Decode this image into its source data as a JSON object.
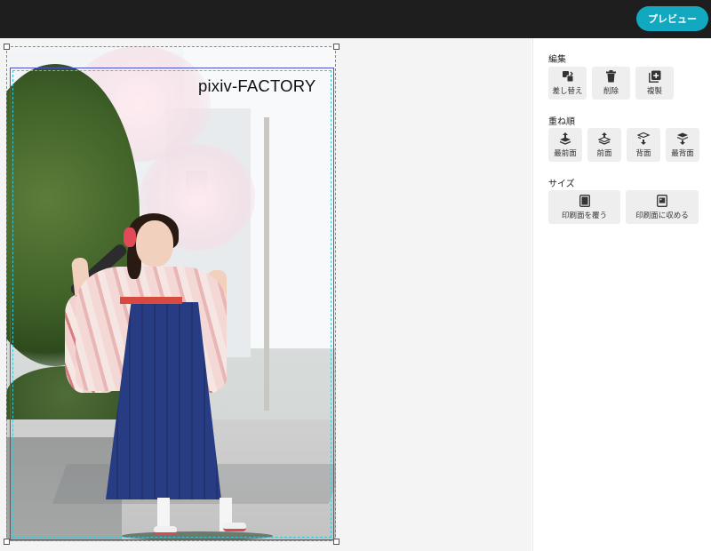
{
  "header": {
    "preview_label": "プレビュー"
  },
  "artwork": {
    "watermark": "pixiv-FACTORY"
  },
  "panel": {
    "edit": {
      "title": "編集",
      "buttons": [
        {
          "label": "差し替え",
          "icon": "swap-image-icon"
        },
        {
          "label": "削除",
          "icon": "trash-icon"
        },
        {
          "label": "複製",
          "icon": "duplicate-icon"
        }
      ]
    },
    "order": {
      "title": "重ね順",
      "buttons": [
        {
          "label": "最前面",
          "icon": "bring-to-front-icon"
        },
        {
          "label": "前面",
          "icon": "bring-forward-icon"
        },
        {
          "label": "背面",
          "icon": "send-backward-icon"
        },
        {
          "label": "最背面",
          "icon": "send-to-back-icon"
        }
      ]
    },
    "size": {
      "title": "サイズ",
      "buttons": [
        {
          "label": "印刷面を覆う",
          "icon": "fill-print-area-icon"
        },
        {
          "label": "印刷面に収める",
          "icon": "fit-print-area-icon"
        }
      ]
    }
  },
  "colors": {
    "topbar": "#1e1e1e",
    "accent": "#12a8c0",
    "guide_blue": "#4650cc",
    "guide_cyan": "#39c6d8"
  }
}
